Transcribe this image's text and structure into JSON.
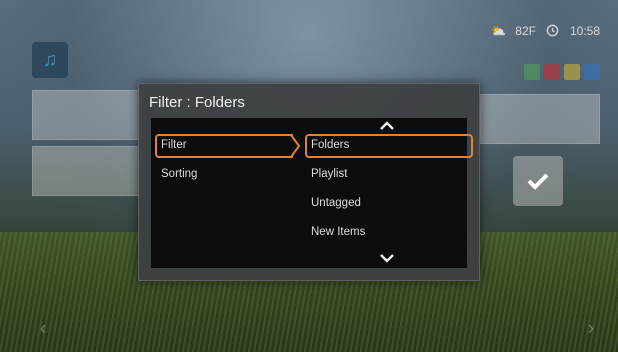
{
  "status": {
    "temperature": "82F",
    "time": "10:58"
  },
  "dialog": {
    "title": "Filter : Folders",
    "left_items": [
      {
        "label": "Filter"
      },
      {
        "label": "Sorting"
      }
    ],
    "right_items": [
      {
        "label": "Folders"
      },
      {
        "label": "Playlist"
      },
      {
        "label": "Untagged"
      },
      {
        "label": "New Items"
      }
    ],
    "selected_left": "Filter",
    "selected_right": "Folders"
  },
  "colors": {
    "accent": "#e4822e",
    "highlight_blue": "#3fa4e6",
    "dialog_bg": "#3c3f42",
    "list_bg": "#0c0c0c"
  },
  "icons": {
    "music": "music-note-icon",
    "weather": "weather-icon",
    "clock": "clock-icon",
    "confirm": "checkmark-icon",
    "scroll_up": "chevron-up-icon",
    "scroll_down": "chevron-down-icon"
  }
}
